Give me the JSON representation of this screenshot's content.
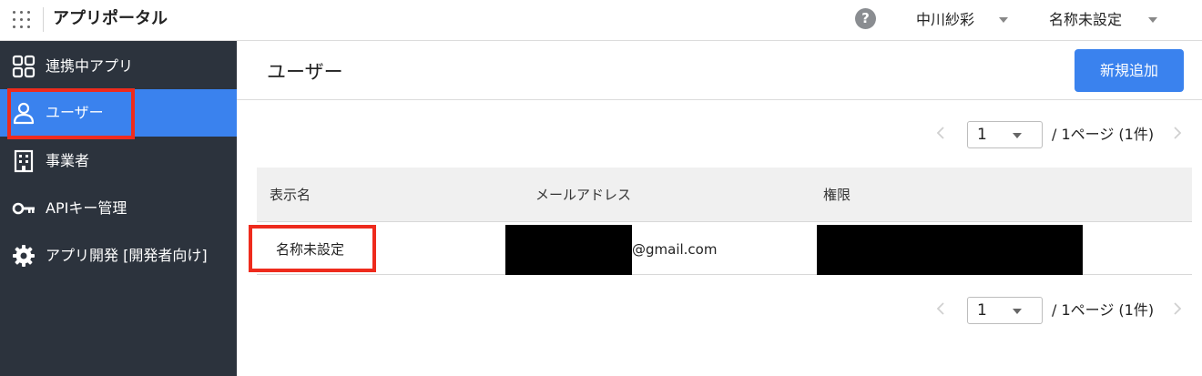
{
  "topbar": {
    "app_title": "アプリポータル",
    "help_icon": "?",
    "user_name": "中川紗彩",
    "org_name": "名称未設定"
  },
  "sidebar": {
    "items": [
      {
        "label": "連携中アプリ",
        "icon": "apps-grid-icon"
      },
      {
        "label": "ユーザー",
        "icon": "user-icon",
        "active": true
      },
      {
        "label": "事業者",
        "icon": "building-icon"
      },
      {
        "label": "APIキー管理",
        "icon": "key-icon"
      },
      {
        "label": "アプリ開発 [開発者向け]",
        "icon": "gear-icon"
      }
    ]
  },
  "main": {
    "title": "ユーザー",
    "add_button": "新規追加",
    "pager_top": {
      "page": "1",
      "info": "/ 1ページ (1件)"
    },
    "pager_bottom": {
      "page": "1",
      "info": "/ 1ページ (1件)"
    },
    "table": {
      "headers": [
        "表示名",
        "メールアドレス",
        "権限"
      ],
      "rows": [
        {
          "display_name": "名称未設定",
          "email_suffix": "@gmail.com"
        }
      ]
    }
  },
  "colors": {
    "accent": "#3a82ee",
    "sidebar_bg": "#2c333d",
    "highlight": "#ee2b1d"
  }
}
